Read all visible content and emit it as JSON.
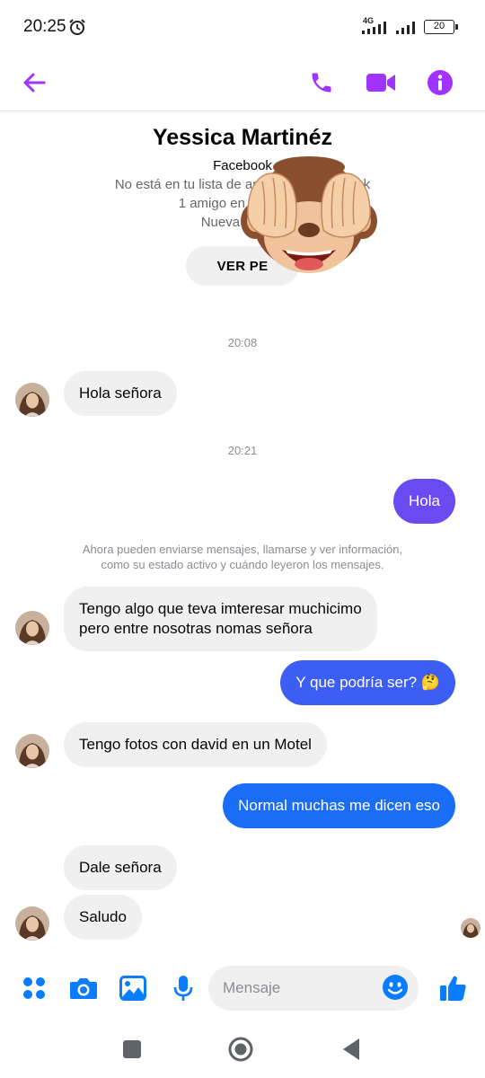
{
  "status_bar": {
    "time": "20:25",
    "network": "4G",
    "battery": "20"
  },
  "header": {
    "icons": [
      "back-arrow-icon",
      "phone-icon",
      "video-camera-icon",
      "info-icon"
    ],
    "accent_color": "#a033ff"
  },
  "profile": {
    "name": "Yessica Martinéz",
    "platform": "Facebook",
    "line1": "No está en tu lista de amigos de Facebook",
    "line2": "1 amigo en común: D",
    "line3": "Nueva cuenta",
    "button": "VER PE"
  },
  "messages": {
    "time1": "20:08",
    "msg1": "Hola señora",
    "time2": "20:21",
    "msg2": "Hola",
    "notice_line1": "Ahora pueden enviarse mensajes, llamarse y ver información,",
    "notice_line2": "como su estado activo y cuándo leyeron los mensajes.",
    "msg3_line1": "Tengo algo que teva imteresar muchicimo",
    "msg3_line2": "pero entre nosotras nomas señora",
    "msg4": "Y que podría ser? 🤔",
    "msg5": "Tengo fotos con david en un Motel",
    "msg6": "Normal muchas me dicen eso",
    "msg7": "Dale señora",
    "msg8": "Saludo"
  },
  "composer": {
    "placeholder": "Mensaje",
    "icons": [
      "apps-icon",
      "camera-icon",
      "gallery-icon",
      "microphone-icon",
      "emoji-icon",
      "thumbs-up-icon"
    ],
    "accent_color": "#0a7cff"
  },
  "bubble_colors": {
    "out_1": "#6a4bf2",
    "out_2": "#3d5ef5",
    "out_3": "#1a6df7",
    "incoming": "#f0f0f0"
  },
  "nav_bar": {
    "icons": [
      "recents-square-icon",
      "home-circle-icon",
      "back-triangle-icon"
    ]
  }
}
